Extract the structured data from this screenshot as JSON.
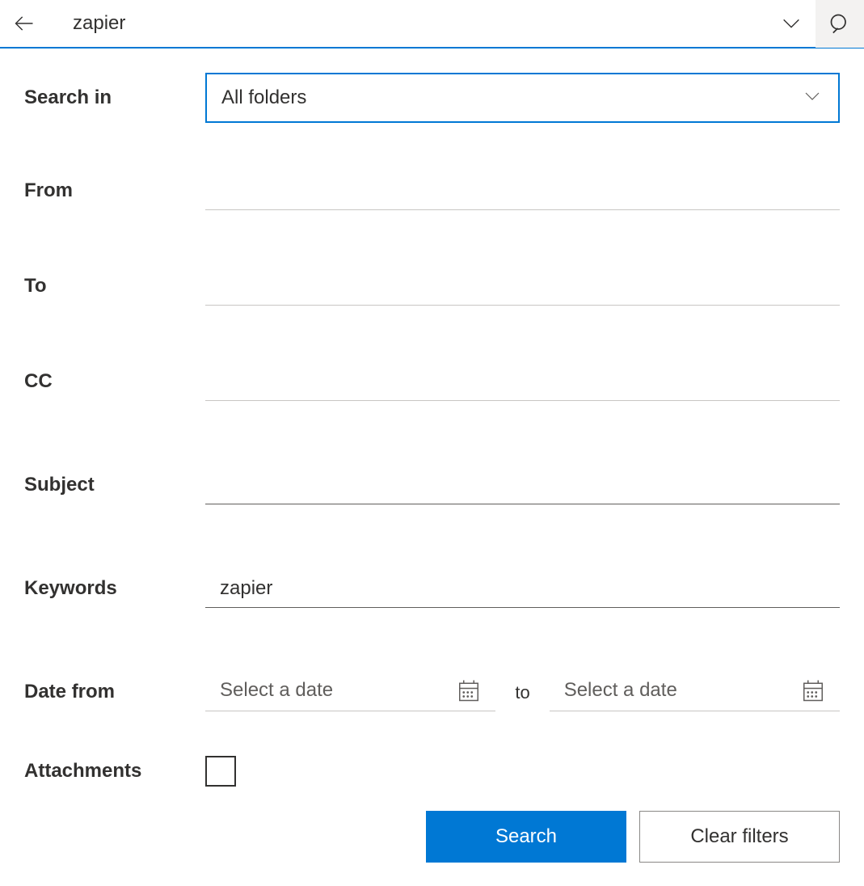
{
  "topbar": {
    "query": "zapier"
  },
  "form": {
    "search_in": {
      "label": "Search in",
      "value": "All folders"
    },
    "from": {
      "label": "From",
      "value": ""
    },
    "to": {
      "label": "To",
      "value": ""
    },
    "cc": {
      "label": "CC",
      "value": ""
    },
    "subject": {
      "label": "Subject",
      "value": ""
    },
    "keywords": {
      "label": "Keywords",
      "value": "zapier"
    },
    "date_from": {
      "label": "Date from",
      "placeholder_start": "Select a date",
      "separator": "to",
      "placeholder_end": "Select a date"
    },
    "attachments": {
      "label": "Attachments"
    }
  },
  "buttons": {
    "search": "Search",
    "clear": "Clear filters"
  }
}
